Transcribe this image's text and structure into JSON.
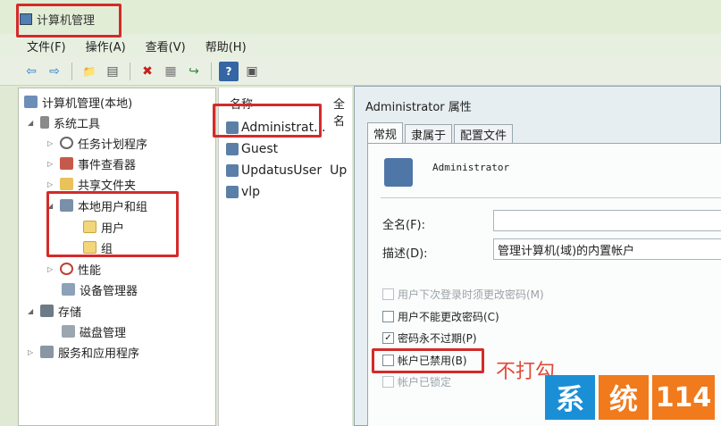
{
  "window": {
    "title": "计算机管理"
  },
  "menu": [
    "文件(F)",
    "操作(A)",
    "查看(V)",
    "帮助(H)"
  ],
  "toolbar": {
    "icons": [
      "back-icon",
      "forward-icon",
      "up-folder-icon",
      "show-tree-icon",
      "delete-icon",
      "properties-icon",
      "export-icon",
      "help-icon",
      "view-icon"
    ],
    "glyphs": [
      "⇦",
      "⇨",
      "📁",
      "▤",
      "✖",
      "▦",
      "↪",
      "?",
      "▣"
    ]
  },
  "tree": [
    {
      "label": "计算机管理(本地)",
      "icon": "computer-icon"
    },
    {
      "label": "系统工具",
      "icon": "tools-icon"
    },
    {
      "label": "任务计划程序",
      "icon": "clock-icon"
    },
    {
      "label": "事件查看器",
      "icon": "event-viewer-icon"
    },
    {
      "label": "共享文件夹",
      "icon": "shared-folder-icon"
    },
    {
      "label": "本地用户和组",
      "icon": "users-icon"
    },
    {
      "label": "用户",
      "icon": "folder-icon"
    },
    {
      "label": "组",
      "icon": "folder-icon"
    },
    {
      "label": "性能",
      "icon": "performance-icon"
    },
    {
      "label": "设备管理器",
      "icon": "device-manager-icon"
    },
    {
      "label": "存储",
      "icon": "storage-icon"
    },
    {
      "label": "磁盘管理",
      "icon": "disk-icon"
    },
    {
      "label": "服务和应用程序",
      "icon": "services-icon"
    }
  ],
  "list": {
    "columns": [
      "名称",
      "全名"
    ],
    "rows": [
      {
        "name": "Administrat...",
        "fullname": ""
      },
      {
        "name": "Guest",
        "fullname": ""
      },
      {
        "name": "UpdatusUser",
        "fullname": "Up"
      },
      {
        "name": "vlp",
        "fullname": ""
      }
    ]
  },
  "dialog": {
    "title": "Administrator 属性",
    "tabs": [
      "常规",
      "隶属于",
      "配置文件"
    ],
    "username": "Administrator",
    "fullname_label": "全名(F):",
    "fullname_value": "",
    "description_label": "描述(D):",
    "description_value": "管理计算机(域)的内置帐户",
    "checkboxes": [
      {
        "label": "用户下次登录时须更改密码(M)",
        "checked": false,
        "enabled": false
      },
      {
        "label": "用户不能更改密码(C)",
        "checked": false,
        "enabled": true
      },
      {
        "label": "密码永不过期(P)",
        "checked": true,
        "enabled": true
      },
      {
        "label": "帐户已禁用(B)",
        "checked": false,
        "enabled": true
      },
      {
        "label": "帐户已锁定",
        "checked": false,
        "enabled": false
      }
    ]
  },
  "annotation": "不打勾",
  "watermark": [
    "系",
    "统",
    "114"
  ],
  "colors": {
    "highlight_red": "#d42a2a",
    "logo_blue": "#1b8fd6",
    "logo_orange": "#f07a1c"
  }
}
